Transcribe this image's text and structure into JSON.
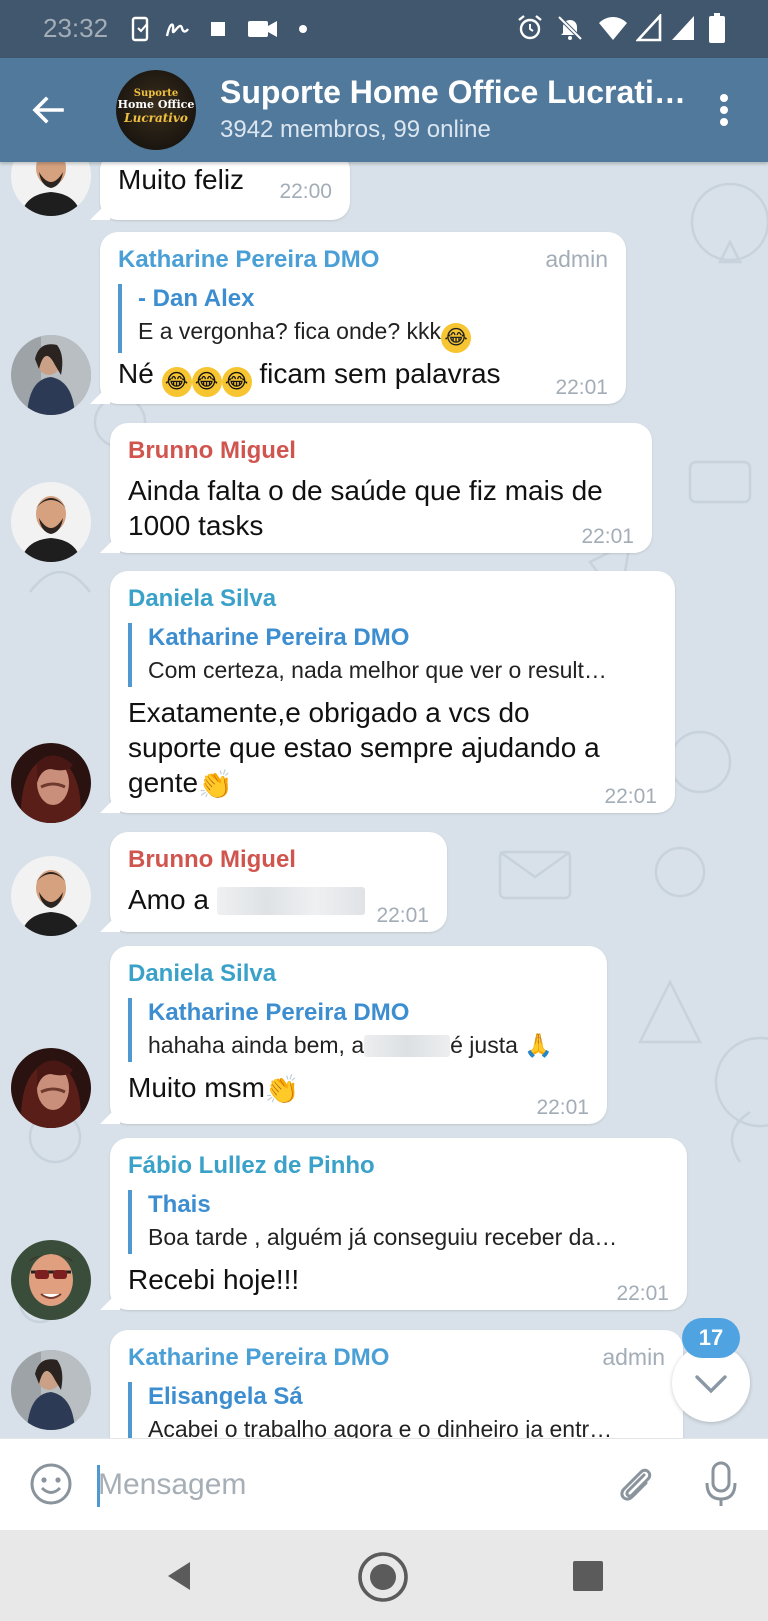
{
  "status_bar": {
    "time": "23:32"
  },
  "header": {
    "title": "Suporte Home Office Lucrati…",
    "subtitle": "3942 membros, 99 online",
    "avatar_lines": [
      "Suporte",
      "Home Office",
      "Lucrativo"
    ]
  },
  "messages": [
    {
      "text": "Muito feliz",
      "time": "22:00"
    },
    {
      "sender": "Katharine Pereira DMO",
      "sender_color": "#4a9fd6",
      "admin": "admin",
      "reply": {
        "name": "- Dan Alex",
        "text": "E a vergonha? fica onde? kkk"
      },
      "text": "Né",
      "text_after": "ficam sem palavras",
      "time": "22:01"
    },
    {
      "sender": "Brunno Miguel",
      "sender_color": "#d1554f",
      "text_line1": "Ainda falta o de saúde que fiz mais de",
      "text_line2": "1000 tasks",
      "time": "22:01"
    },
    {
      "sender": "Daniela Silva",
      "sender_color": "#3aa2c8",
      "reply": {
        "name": "Katharine Pereira DMO",
        "text": "Com certeza, nada melhor que ver o result…"
      },
      "text_line1": "Exatamente,e obrigado a vcs do",
      "text_line2": "suporte que estao sempre ajudando a",
      "text_line3": "gente",
      "time": "22:01"
    },
    {
      "sender": "Brunno Miguel",
      "sender_color": "#d1554f",
      "text": "Amo a",
      "time": "22:01"
    },
    {
      "sender": "Daniela Silva",
      "sender_color": "#3aa2c8",
      "reply": {
        "name": "Katharine Pereira DMO",
        "text_before": "hahaha ainda bem, a",
        "text_after": "é justa"
      },
      "text": "Muito msm",
      "time": "22:01"
    },
    {
      "sender": "Fábio Lullez de Pinho",
      "sender_color": "#3aa2c8",
      "reply": {
        "name": "Thais",
        "text": "Boa tarde , alguém já conseguiu receber da…"
      },
      "text": "Recebi hoje!!!",
      "time": "22:01"
    },
    {
      "sender": "Katharine Pereira DMO",
      "sender_color": "#4a9fd6",
      "admin": "admin",
      "reply": {
        "name": "Elisangela Sá",
        "text": "Acabei o trabalho agora e o dinheiro ja entr…"
      }
    }
  ],
  "unread_count": "17",
  "input": {
    "placeholder": "Mensagem"
  }
}
